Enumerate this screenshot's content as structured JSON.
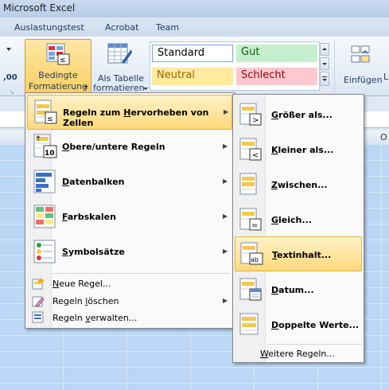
{
  "window": {
    "title": "Microsoft Excel"
  },
  "tabs": [
    "Auslastungstest",
    "Acrobat",
    "Team"
  ],
  "ribbon": {
    "cond_format": {
      "line1": "Bedingte",
      "line2": "Formatierung"
    },
    "as_table": {
      "line1": "Als Tabelle",
      "line2": "formatieren"
    },
    "number_fragment": ",00",
    "insert": "Einfügen",
    "insert_fragment": "L",
    "styles": [
      {
        "label": "Standard",
        "bg": "#ffffff",
        "fg": "#000000"
      },
      {
        "label": "Gut",
        "bg": "#c6efce",
        "fg": "#006100"
      },
      {
        "label": "Neutral",
        "bg": "#ffeb9c",
        "fg": "#9c6500"
      },
      {
        "label": "Schlecht",
        "bg": "#ffc7ce",
        "fg": "#9c0006"
      }
    ]
  },
  "column_header_fragment": "O",
  "menu_main": {
    "items": [
      {
        "pre": "Regeln zum ",
        "key": "H",
        "post": "ervorheben von Zellen",
        "icon": "highlight-cells-rules-icon",
        "submenu": true,
        "highlighted": true
      },
      {
        "pre": "",
        "key": "O",
        "post": "bere/untere Regeln",
        "icon": "top-bottom-rules-icon",
        "submenu": true
      },
      {
        "pre": "",
        "key": "D",
        "post": "atenbalken",
        "icon": "data-bars-icon",
        "submenu": true
      },
      {
        "pre": "",
        "key": "F",
        "post": "arbskalen",
        "icon": "color-scales-icon",
        "submenu": true
      },
      {
        "pre": "",
        "key": "S",
        "post": "ymbolsätze",
        "icon": "icon-sets-icon",
        "submenu": true
      }
    ],
    "small_items": [
      {
        "pre": "",
        "key": "N",
        "post": "eue Regel...",
        "icon": "new-rule-icon",
        "submenu": false
      },
      {
        "pre": "Regeln ",
        "key": "l",
        "post": "öschen",
        "icon": "clear-rules-icon",
        "submenu": true
      },
      {
        "pre": "Regeln ",
        "key": "v",
        "post": "erwalten...",
        "icon": "manage-rules-icon",
        "submenu": false
      }
    ]
  },
  "menu_sub": {
    "items": [
      {
        "pre": "",
        "key": "G",
        "post": "rößer als...",
        "icon": "greater-than-icon"
      },
      {
        "pre": "",
        "key": "K",
        "post": "leiner als...",
        "icon": "less-than-icon"
      },
      {
        "pre": "",
        "key": "Z",
        "post": "wischen...",
        "icon": "between-icon"
      },
      {
        "pre": "",
        "key": "G",
        "post": "leich...",
        "icon": "equal-to-icon"
      },
      {
        "pre": "",
        "key": "T",
        "post": "extinhalt...",
        "icon": "text-contains-icon",
        "highlighted": true
      },
      {
        "pre": "",
        "key": "D",
        "post": "atum...",
        "icon": "date-occurring-icon"
      },
      {
        "pre": "",
        "key": "D",
        "post": "oppelte Werte...",
        "icon": "duplicate-values-icon"
      }
    ],
    "more": {
      "pre": "",
      "key": "W",
      "post": "eitere Regeln..."
    }
  }
}
